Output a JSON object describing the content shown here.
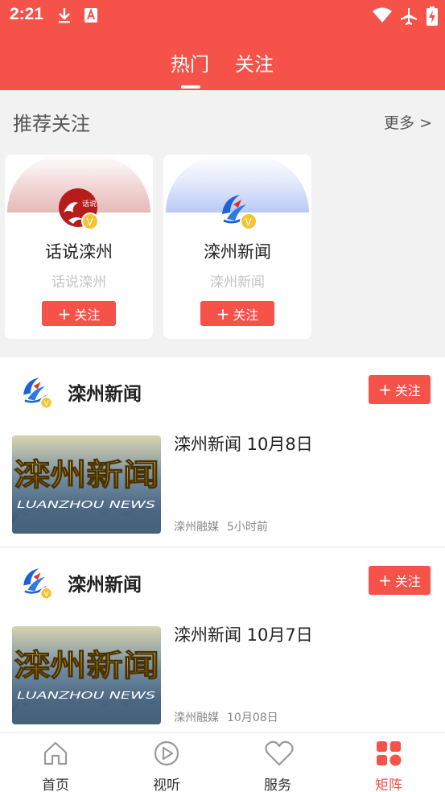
{
  "status_bar": {
    "time": "2:21"
  },
  "header_tabs": [
    {
      "label": "热门",
      "active": true
    },
    {
      "label": "关注",
      "active": false
    }
  ],
  "recommend": {
    "title": "推荐关注",
    "more": "更多 >",
    "cards": [
      {
        "name": "话说滦州",
        "subtitle": "话说滦州",
        "follow_label": "关注",
        "logo_text": "话说"
      },
      {
        "name": "滦州新闻",
        "subtitle": "滦州新闻",
        "follow_label": "关注"
      }
    ]
  },
  "feed": [
    {
      "source": "滦州新闻",
      "follow_label": "关注",
      "title": "滦州新闻 10月8日",
      "publisher": "滦州融媒",
      "time": "5小时前",
      "thumb_text": "滦州新闻",
      "thumb_sub": "LUANZHOU NEWS"
    },
    {
      "source": "滦州新闻",
      "follow_label": "关注",
      "title": "滦州新闻 10月7日",
      "publisher": "滦州融媒",
      "time": "10月08日",
      "thumb_text": "滦州新闻",
      "thumb_sub": "LUANZHOU NEWS"
    }
  ],
  "bottom_nav": [
    {
      "label": "首页",
      "icon": "home-icon",
      "active": false
    },
    {
      "label": "视听",
      "icon": "play-icon",
      "active": false
    },
    {
      "label": "服务",
      "icon": "heart-icon",
      "active": false
    },
    {
      "label": "矩阵",
      "icon": "matrix-icon",
      "active": true
    }
  ],
  "colors": {
    "accent": "#f5524a",
    "badge": "#f6c331",
    "logo_blue": "#1e63d6",
    "logo_red": "#e12f2a"
  }
}
